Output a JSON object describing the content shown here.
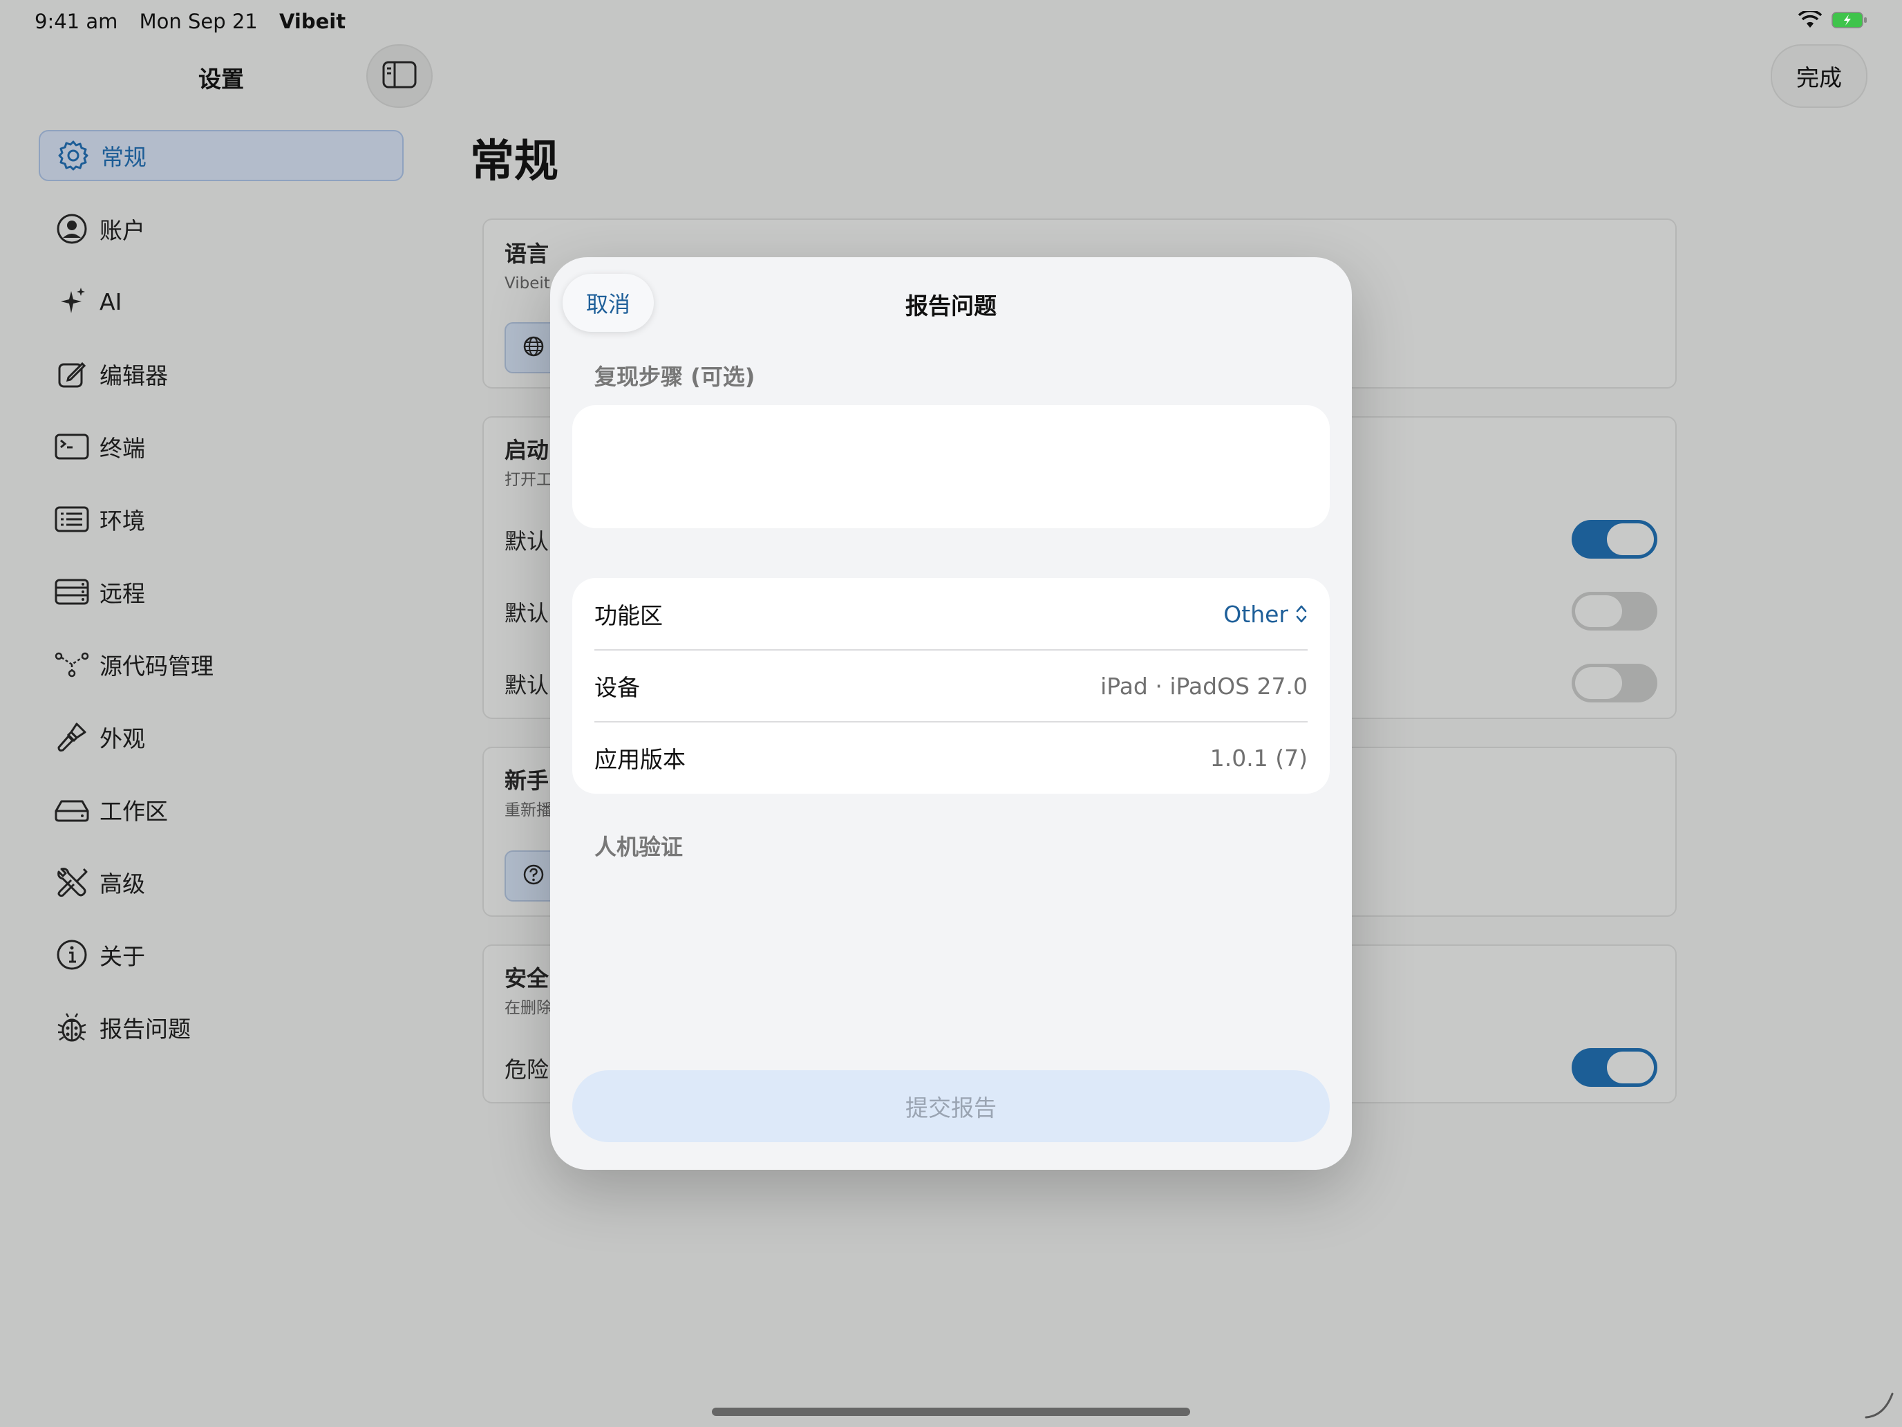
{
  "status_bar": {
    "time": "9:41 am",
    "date": "Mon Sep 21",
    "app": "Vibeit"
  },
  "sidebar": {
    "title": "设置",
    "items": [
      {
        "label": "常规",
        "icon": "gear-icon",
        "active": true
      },
      {
        "label": "账户",
        "icon": "person-circle-icon"
      },
      {
        "label": "AI",
        "icon": "sparkles-icon"
      },
      {
        "label": "编辑器",
        "icon": "square-pencil-icon"
      },
      {
        "label": "终端",
        "icon": "terminal-icon"
      },
      {
        "label": "环境",
        "icon": "list-icon"
      },
      {
        "label": "远程",
        "icon": "server-icon"
      },
      {
        "label": "源代码管理",
        "icon": "branch-icon"
      },
      {
        "label": "外观",
        "icon": "paintbrush-icon"
      },
      {
        "label": "工作区",
        "icon": "drive-icon"
      },
      {
        "label": "高级",
        "icon": "tools-icon"
      },
      {
        "label": "关于",
        "icon": "info-circle-icon"
      }
    ],
    "report": {
      "label": "报告问题",
      "icon": "ladybug-icon"
    }
  },
  "header": {
    "done_label": "完成"
  },
  "main": {
    "title": "常规",
    "cards": {
      "language": {
        "heading": "语言",
        "sub": "Vibeit 显"
      },
      "startup": {
        "heading": "启动",
        "sub": "打开工",
        "rows": [
          "默认",
          "默认",
          "默认"
        ],
        "toggles": [
          true,
          false,
          false
        ]
      },
      "onboarding": {
        "heading": "新手",
        "sub": "重新播"
      },
      "safety": {
        "heading": "安全",
        "sub": "在删除",
        "row": "危险",
        "toggle": true
      }
    }
  },
  "modal": {
    "cancel_label": "取消",
    "title": "报告问题",
    "steps_label": "复现步骤 (可选)",
    "steps_value": "",
    "info_rows": [
      {
        "key": "功能区",
        "value": "Other",
        "type": "picker"
      },
      {
        "key": "设备",
        "value": "iPad · iPadOS 27.0"
      },
      {
        "key": "应用版本",
        "value": "1.0.1 (7)"
      }
    ],
    "captcha_label": "人机验证",
    "submit_label": "提交报告"
  },
  "colors": {
    "accent": "#1e5f99",
    "switch_on": "#1c5e96",
    "submit_bg": "#dde9f9"
  }
}
